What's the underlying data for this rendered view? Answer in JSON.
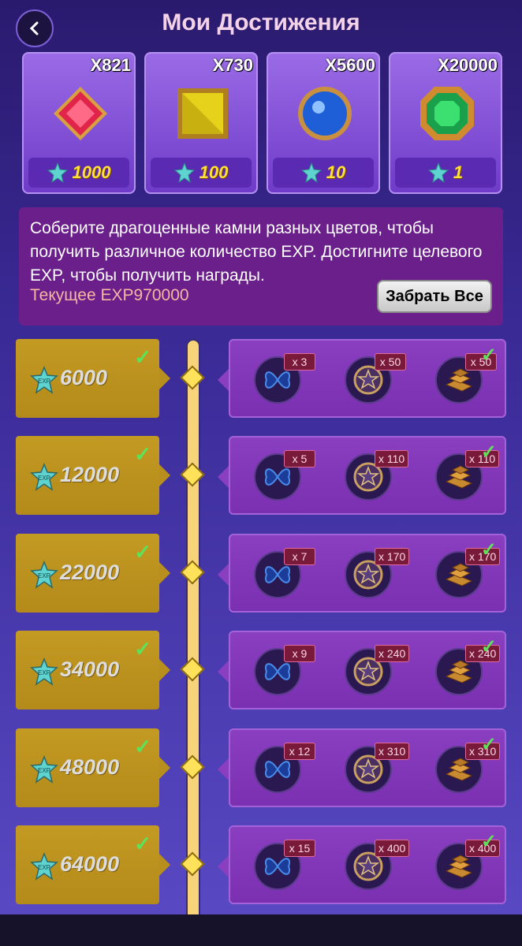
{
  "header": {
    "title": "Мои Достижения"
  },
  "gems": [
    {
      "name": "red-gem-icon",
      "count": "X821",
      "exp": "1000"
    },
    {
      "name": "yellow-gem-icon",
      "count": "X730",
      "exp": "100"
    },
    {
      "name": "blue-gem-icon",
      "count": "X5600",
      "exp": "10"
    },
    {
      "name": "green-gem-icon",
      "count": "X20000",
      "exp": "1"
    }
  ],
  "info": {
    "text": "Соберите драгоценные камни разных цветов, чтобы получить различное количество EXP. Достигните целевого EXP, чтобы получить награды.",
    "current_exp": "Текущее EXP970000",
    "claim_all": "Забрать Все"
  },
  "milestones": [
    {
      "exp": "6000",
      "rewards": [
        "x 3",
        "x 50",
        "x 50"
      ]
    },
    {
      "exp": "12000",
      "rewards": [
        "x 5",
        "x 110",
        "x 110"
      ]
    },
    {
      "exp": "22000",
      "rewards": [
        "x 7",
        "x 170",
        "x 170"
      ]
    },
    {
      "exp": "34000",
      "rewards": [
        "x 9",
        "x 240",
        "x 240"
      ]
    },
    {
      "exp": "48000",
      "rewards": [
        "x 12",
        "x 310",
        "x 310"
      ]
    },
    {
      "exp": "64000",
      "rewards": [
        "x 15",
        "x 400",
        "x 400"
      ]
    }
  ],
  "icons": {
    "exp_star": "exp-star-icon",
    "check": "checkmark-icon",
    "reward_types": [
      "butterfly-icon",
      "star-coin-icon",
      "gold-bars-icon"
    ]
  }
}
